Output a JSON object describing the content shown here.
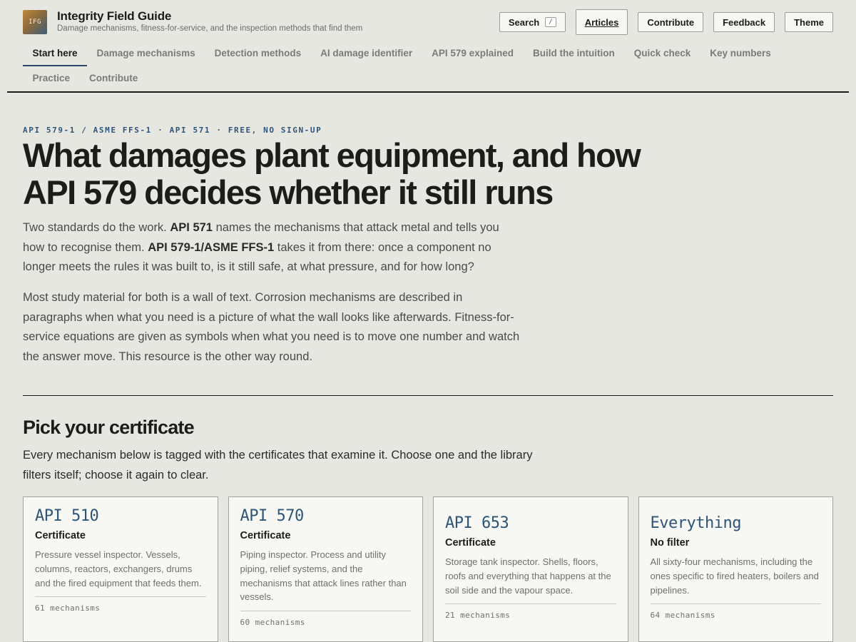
{
  "brand": {
    "logo_text": "IFG",
    "title": "Integrity Field Guide",
    "tagline": "Damage mechanisms, fitness-for-service, and the inspection methods that find them"
  },
  "topbar": {
    "search_label": "Search",
    "search_shortcut": "/",
    "articles_label": "Articles",
    "contribute_label": "Contribute",
    "feedback_label": "Feedback",
    "theme_label": "Theme"
  },
  "nav": {
    "row1": [
      "Start here",
      "Damage mechanisms",
      "Detection methods",
      "AI damage identifier",
      "API 579 explained",
      "Build the intuition",
      "Quick check",
      "Key numbers"
    ],
    "row2": [
      "Practice",
      "Contribute"
    ]
  },
  "hero": {
    "eyebrow": "API 579-1 / ASME FFS-1 · API 571 · FREE, NO SIGN-UP",
    "title": "What damages plant equipment, and how API 579 decides whether it still runs",
    "p1": {
      "t1": "Two standards do the work. ",
      "b1": "API 571",
      "t2": " names the mechanisms that attack metal and tells you how to recognise them. ",
      "b2": "API 579-1/ASME FFS-1",
      "t3": " takes it from there: once a component no longer meets the rules it was built to, is it still safe, at what pressure, and for how long?"
    },
    "p2": "Most study material for both is a wall of text. Corrosion mechanisms are described in paragraphs when what you need is a picture of what the wall looks like afterwards. Fitness-for-service equations are given as symbols when what you need is to move one number and watch the answer move. This resource is the other way round."
  },
  "certificates": {
    "title": "Pick your certificate",
    "intro": "Every mechanism below is tagged with the certificates that examine it. Choose one and the library filters itself; choose it again to clear.",
    "cards": [
      {
        "code": "API 510",
        "subtitle": "Certificate",
        "desc": "Pressure vessel inspector. Vessels, columns, reactors, exchangers, drums and the fired equipment that feeds them.",
        "count": "61 mechanisms"
      },
      {
        "code": "API 570",
        "subtitle": "Certificate",
        "desc": "Piping inspector. Process and utility piping, relief systems, and the mechanisms that attack lines rather than vessels.",
        "count": "60 mechanisms"
      },
      {
        "code": "API 653",
        "subtitle": "Certificate",
        "desc": "Storage tank inspector. Shells, floors, roofs and everything that happens at the soil side and the vapour space.",
        "count": "21 mechanisms"
      },
      {
        "code": "Everything",
        "subtitle": "No filter",
        "desc": "All sixty-four mechanisms, including the ones specific to fired heaters, boilers and pipelines.",
        "count": "64 mechanisms"
      }
    ]
  }
}
